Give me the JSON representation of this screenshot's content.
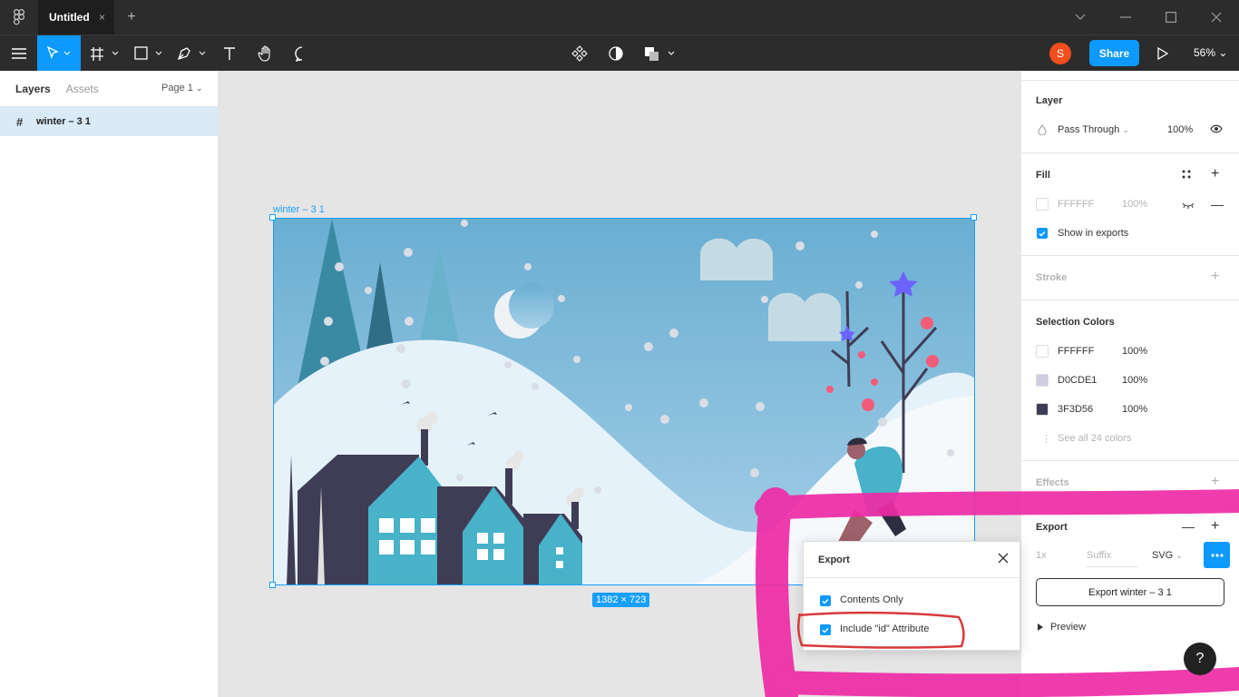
{
  "titlebar": {
    "tab_title": "Untitled",
    "tab_close": "×",
    "tab_add": "+"
  },
  "toolbar": {
    "share_label": "Share",
    "avatar_initial": "S",
    "zoom": "56%"
  },
  "left_panel": {
    "tabs": [
      "Layers",
      "Assets"
    ],
    "page": "Page 1",
    "layers": [
      {
        "name": "winter – 3 1"
      }
    ]
  },
  "canvas": {
    "frame_label": "winter – 3 1",
    "dimensions": "1382 × 723"
  },
  "right_panel": {
    "layer": {
      "title": "Layer",
      "blend": "Pass Through",
      "opacity": "100%"
    },
    "fill": {
      "title": "Fill",
      "hex": "FFFFFF",
      "opacity": "100%",
      "show_in_exports": "Show in exports"
    },
    "stroke": {
      "title": "Stroke"
    },
    "selection_colors": {
      "title": "Selection Colors",
      "colors": [
        {
          "hex": "FFFFFF",
          "opacity": "100%",
          "swatch": "#ffffff"
        },
        {
          "hex": "D0CDE1",
          "opacity": "100%",
          "swatch": "#d0cde1"
        },
        {
          "hex": "3F3D56",
          "opacity": "100%",
          "swatch": "#3f3d56"
        }
      ],
      "see_all": "See all 24 colors"
    },
    "effects": {
      "title": "Effects"
    },
    "export": {
      "title": "Export",
      "scale": "1x",
      "suffix_placeholder": "Suffix",
      "format": "SVG",
      "button": "Export winter – 3 1",
      "preview": "Preview"
    }
  },
  "popup": {
    "title": "Export",
    "options": [
      {
        "label": "Contents Only",
        "checked": true
      },
      {
        "label": "Include \"id\" Attribute",
        "checked": true
      }
    ]
  },
  "help": "?",
  "colors": {
    "accent": "#0d99ff",
    "selection": "#18a0fb",
    "annotation_pink": "#ee2ba6",
    "annotation_red": "#d83a3a"
  }
}
